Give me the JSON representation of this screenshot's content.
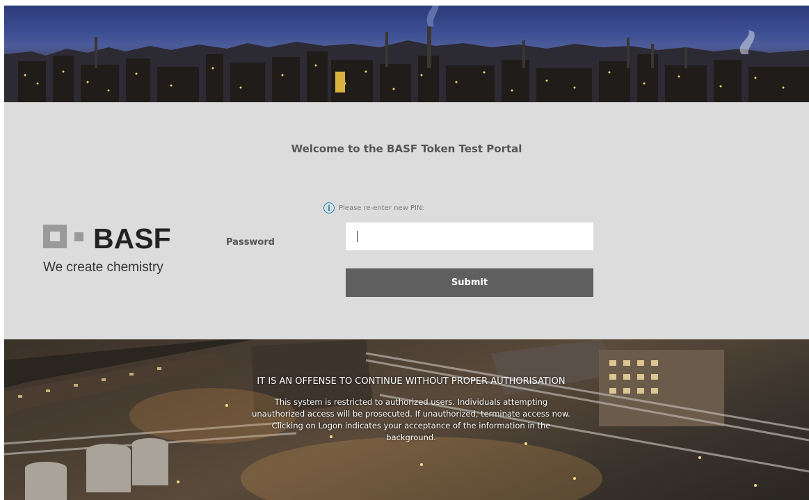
{
  "page": {
    "welcome_title": "Welcome to the BASF Token Test Portal"
  },
  "brand": {
    "logo_text": "BASF",
    "tagline": "We create chemistry"
  },
  "form": {
    "info_message": "Please re-enter new PIN:",
    "password_label": "Password",
    "password_value": "",
    "submit_label": "Submit"
  },
  "legal": {
    "heading": "IT IS AN OFFENSE TO CONTINUE WITHOUT PROPER AUTHORISATION",
    "body": "This system is restricted to authorized users. Individuals attempting unauthorized access will be prosecuted. If unauthorized, terminate access now. Clicking on Logon indicates your acceptance of the information in the background."
  },
  "icons": {
    "info": "info-icon"
  },
  "colors": {
    "panel_background": "#dcdcdc",
    "submit_background": "#5f5f5f",
    "info_blue": "#1e88c7",
    "logo_dark": "#222222",
    "logo_grey": "#9a9a9a"
  }
}
